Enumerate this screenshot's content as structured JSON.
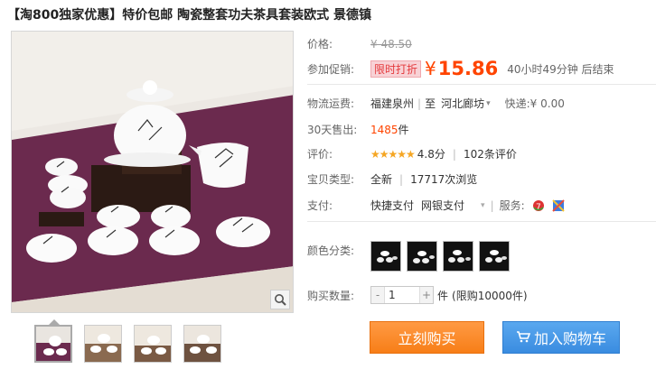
{
  "title": "【淘800独家优惠】特价包邮 陶瓷整套功夫茶具套装欧式 景德镇",
  "price": {
    "label": "价格:",
    "original": "¥ 48.50"
  },
  "promo": {
    "label": "参加促销:",
    "tag": "限时打折",
    "currency": "¥",
    "price": "15.86",
    "countdown": "40小时49分钟 后结束"
  },
  "shipping": {
    "label": "物流运费:",
    "from": "福建泉州",
    "to_label": "至",
    "to": "河北廊坊",
    "fee_label": "快递:",
    "fee": "¥ 0.00"
  },
  "sales": {
    "label": "30天售出:",
    "count": "1485",
    "unit": "件"
  },
  "rating": {
    "label": "评价:",
    "stars": "★★★★★",
    "score": "4.8分",
    "reviews": "102条评价"
  },
  "item_type": {
    "label": "宝贝类型:",
    "condition": "全新",
    "views": "17717次浏览"
  },
  "payment": {
    "label": "支付:",
    "methods": [
      "快捷支付",
      "网银支付"
    ],
    "service_label": "服务:"
  },
  "color": {
    "label": "颜色分类:",
    "option_count": 4
  },
  "quantity": {
    "label": "购买数量:",
    "value": "1",
    "unit": "件",
    "limit": "(限购10000件)",
    "minus": "-",
    "plus": "+"
  },
  "buttons": {
    "buy": "立刻购买",
    "cart": "加入购物车"
  },
  "icons": {
    "zoom": "magnifier-icon",
    "cart": "cart-icon",
    "service1": "service-badge-icon",
    "service2": "flag-badge-icon"
  }
}
